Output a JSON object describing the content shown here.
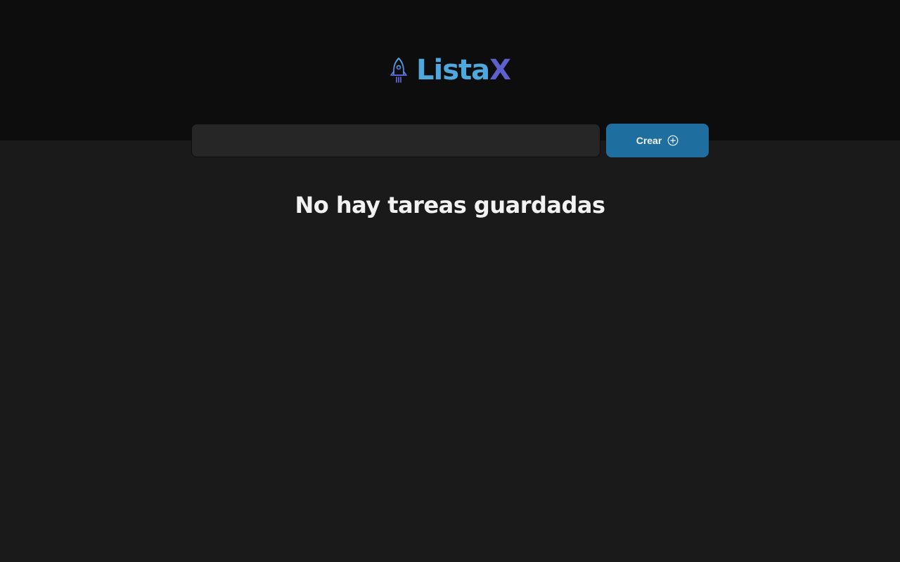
{
  "header": {
    "logo": {
      "icon": "rocket-icon",
      "text_part1": "Lista",
      "text_part2": "X",
      "color_part1": "#4ea8de",
      "color_part2": "#5e60ce"
    }
  },
  "form": {
    "input_value": "",
    "input_placeholder": "",
    "create_label": "Crear",
    "create_icon": "plus-circle-icon",
    "button_color": "#1e6f9f"
  },
  "tasks": {
    "empty_message": "No hay tareas guardadas"
  }
}
